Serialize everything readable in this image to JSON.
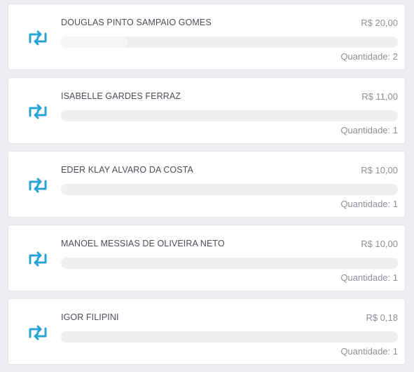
{
  "colors": {
    "accent": "#29a3d6",
    "background": "#eceef1",
    "card": "#ffffff",
    "name_text": "#4a4f5a",
    "muted_text": "#8c9096",
    "bar_track": "#eeeff1"
  },
  "items": [
    {
      "icon": "retweet-icon",
      "name": "DOUGLAS PINTO SAMPAIO GOMES",
      "amount": "R$ 20,00",
      "quantity": "Quantidade: 2",
      "progress": 0.2
    },
    {
      "icon": "retweet-icon",
      "name": "ISABELLE GARDES FERRAZ",
      "amount": "R$ 11,00",
      "quantity": "Quantidade: 1",
      "progress": 0
    },
    {
      "icon": "retweet-icon",
      "name": "EDER KLAY ALVARO DA COSTA",
      "amount": "R$ 10,00",
      "quantity": "Quantidade: 1",
      "progress": 0
    },
    {
      "icon": "retweet-icon",
      "name": "MANOEL MESSIAS DE OLIVEIRA NETO",
      "amount": "R$ 10,00",
      "quantity": "Quantidade: 1",
      "progress": 0
    },
    {
      "icon": "retweet-icon",
      "name": "IGOR FILIPINI",
      "amount": "R$ 0,18",
      "quantity": "Quantidade: 1",
      "progress": 0
    }
  ]
}
